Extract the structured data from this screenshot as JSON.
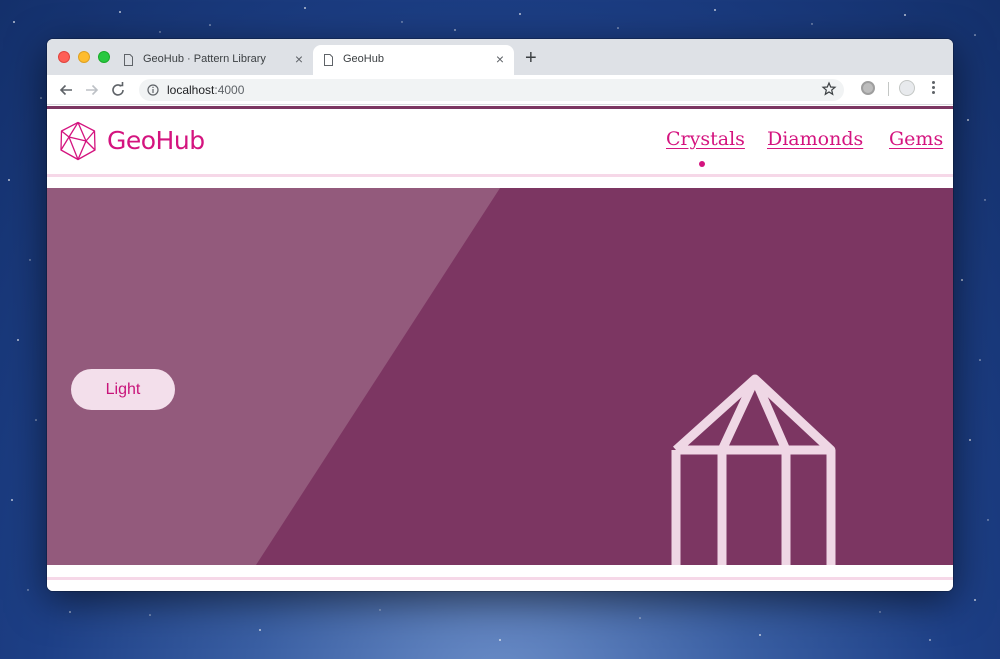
{
  "browser": {
    "tabs": [
      {
        "title": "GeoHub · Pattern Library",
        "active": false
      },
      {
        "title": "GeoHub",
        "active": true
      }
    ],
    "new_tab_label": "+",
    "close_label": "×",
    "address": {
      "host": "localhost",
      "port": ":4000"
    }
  },
  "site": {
    "brand": "GeoHub",
    "nav": [
      {
        "label": "Crystals",
        "active": true
      },
      {
        "label": "Diamonds",
        "active": false
      },
      {
        "label": "Gems",
        "active": false
      }
    ],
    "hero": {
      "button_label": "Light"
    }
  },
  "colors": {
    "brand": "#d4147f",
    "hero_background": "#7c3662",
    "hero_highlight": "#935a7c",
    "accent_light": "#f3dfeb"
  },
  "icons": [
    "page-icon",
    "back-arrow-icon",
    "forward-arrow-icon",
    "reload-icon",
    "info-icon",
    "star-icon",
    "extension-icon",
    "profile-icon",
    "more-menu-icon",
    "geohub-logo-icon",
    "crystal-illustration"
  ]
}
